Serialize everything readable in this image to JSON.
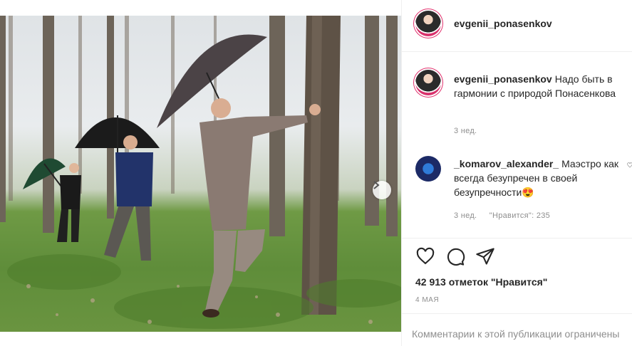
{
  "post": {
    "author": "evgenii_ponasenkov",
    "caption": {
      "username": "evgenii_ponasenkov",
      "text": "Надо быть в гармонии с природой Понасенкова",
      "time": "3 нед."
    },
    "comments": [
      {
        "username": "_komarov_alexander_",
        "text": "Маэстро как всегда безупречен в своей безупречности😍",
        "time": "3 нед.",
        "likes": "\"Нравится\": 235"
      }
    ],
    "likes_text": "42 913 отметок \"Нравится\"",
    "date": "4 МАЯ",
    "comments_closed": "Комментарии к этой публикации ограничены"
  },
  "icons": {
    "like": "heart-icon",
    "comment": "comment-icon",
    "share": "share-icon",
    "next": "chevron-right-icon"
  },
  "carousel": {
    "slides": 2,
    "current": 1
  },
  "colors": {
    "avatar_ring": "#e1306c",
    "muted": "#8e8e8e"
  }
}
